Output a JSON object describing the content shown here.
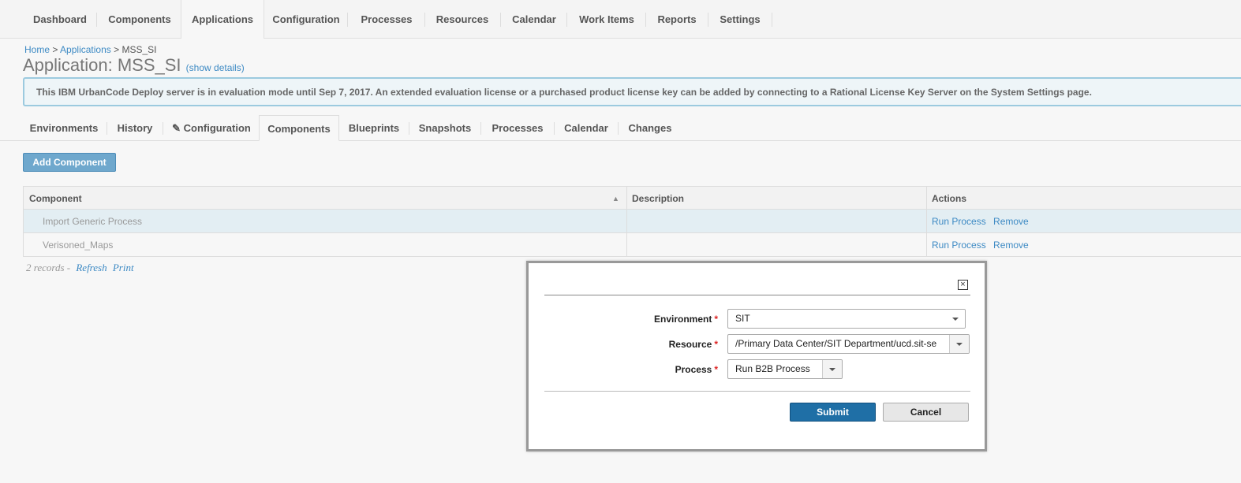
{
  "nav": {
    "items": [
      "Dashboard",
      "Components",
      "Applications",
      "Configuration",
      "Processes",
      "Resources",
      "Calendar",
      "Work Items",
      "Reports",
      "Settings"
    ],
    "active": "Applications"
  },
  "breadcrumb": {
    "home": "Home",
    "applications": "Applications",
    "current": "MSS_SI",
    "sep": ">"
  },
  "page": {
    "title": "Application: MSS_SI",
    "show_details": "(show details)"
  },
  "banner": {
    "text": "This IBM UrbanCode Deploy server is in evaluation mode until Sep 7, 2017. An extended evaluation license or a purchased product license key can be added by connecting to a Rational License Key Server on the System Settings page."
  },
  "subtabs": {
    "items": [
      "Environments",
      "History",
      "Configuration",
      "Components",
      "Blueprints",
      "Snapshots",
      "Processes",
      "Calendar",
      "Changes"
    ],
    "active": "Components",
    "configuration_icon": "pencil-icon"
  },
  "toolbar": {
    "add_component": "Add Component"
  },
  "table": {
    "headers": {
      "component": "Component",
      "description": "Description",
      "actions": "Actions"
    },
    "rows": [
      {
        "component": "Import Generic Process",
        "description": "",
        "run": "Run Process",
        "remove": "Remove"
      },
      {
        "component": "Verisoned_Maps",
        "description": "",
        "run": "Run Process",
        "remove": "Remove"
      }
    ],
    "footer": {
      "records": "2 records",
      "dash": "-",
      "refresh": "Refresh",
      "print": "Print"
    }
  },
  "dialog": {
    "close_icon": "close-icon",
    "fields": {
      "environment": {
        "label": "Environment",
        "value": "SIT"
      },
      "resource": {
        "label": "Resource",
        "value": "/Primary Data Center/SIT Department/ucd.sit-se"
      },
      "process": {
        "label": "Process",
        "value": "Run B2B Process"
      }
    },
    "required_mark": "*",
    "submit": "Submit",
    "cancel": "Cancel"
  }
}
